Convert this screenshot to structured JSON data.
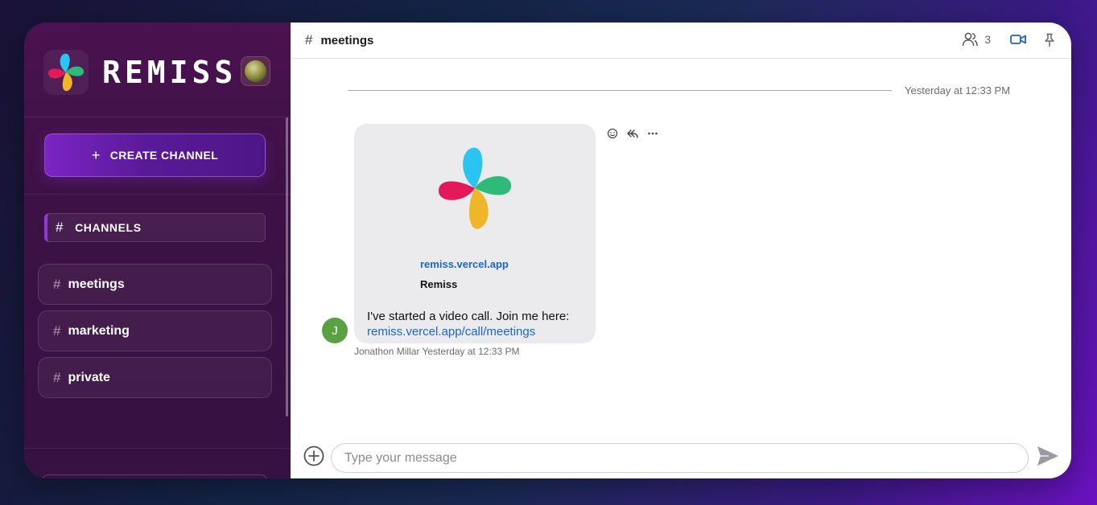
{
  "sidebar": {
    "app_name": "REMISS",
    "create_channel_label": "CREATE CHANNEL",
    "channels_header": "CHANNELS",
    "channels": [
      {
        "label": "meetings"
      },
      {
        "label": "marketing"
      },
      {
        "label": "private"
      }
    ]
  },
  "topbar": {
    "channel_name": "meetings",
    "member_count": "3"
  },
  "conversation": {
    "date_divider": "Yesterday at 12:33 PM",
    "message": {
      "avatar_initial": "J",
      "preview_link": "remiss.vercel.app",
      "preview_title": "Remiss",
      "text": "I've started a video call. Join me here:",
      "link": "remiss.vercel.app/call/meetings",
      "meta": "Jonathon Millar Yesterday at 12:33 PM"
    }
  },
  "composer": {
    "placeholder": "Type your message"
  },
  "colors": {
    "accent": "#7b24c4",
    "link": "#1a66cc",
    "avatar_green": "#58a242",
    "logo_blue": "#29c4f0",
    "logo_green": "#2fba7a",
    "logo_red": "#e3195a",
    "logo_yellow": "#f0b62a"
  }
}
